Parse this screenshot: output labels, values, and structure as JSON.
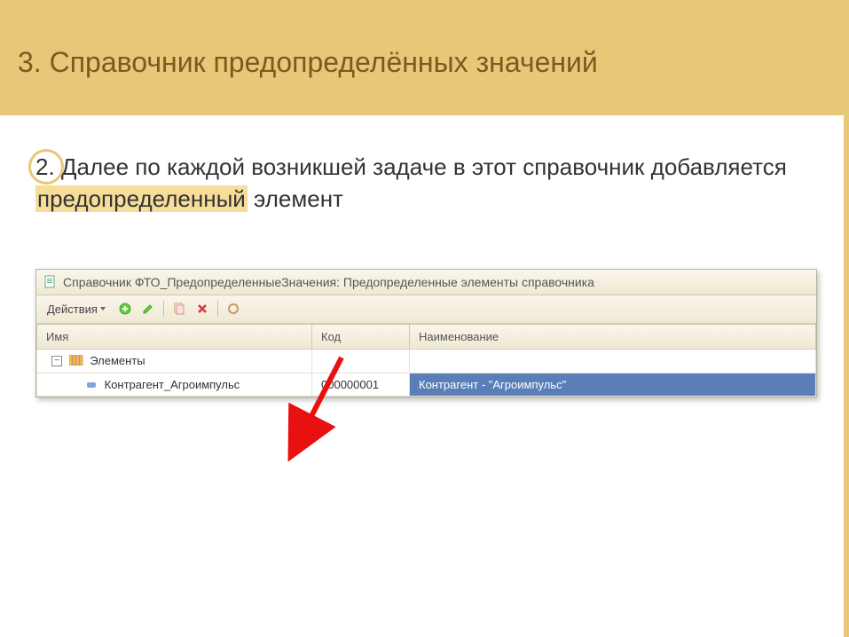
{
  "slide": {
    "title": "3. Справочник предопределённых значений",
    "list_number": "2.",
    "body_before": "Далее по каждой возникшей задаче в этот справочник добавляется ",
    "body_highlight": "предопределенный",
    "body_after": " элемент"
  },
  "window": {
    "title": "Справочник ФТО_ПредопределенныеЗначения: Предопределенные элементы справочника",
    "actions_label": "Действия"
  },
  "grid": {
    "headers": {
      "name": "Имя",
      "code": "Код",
      "title": "Наименование"
    },
    "root_label": "Элементы",
    "rows": [
      {
        "name": "Контрагент_Агроимпульс",
        "code": "000000001",
        "title": "Контрагент - \"Агроимпульс\""
      }
    ]
  }
}
